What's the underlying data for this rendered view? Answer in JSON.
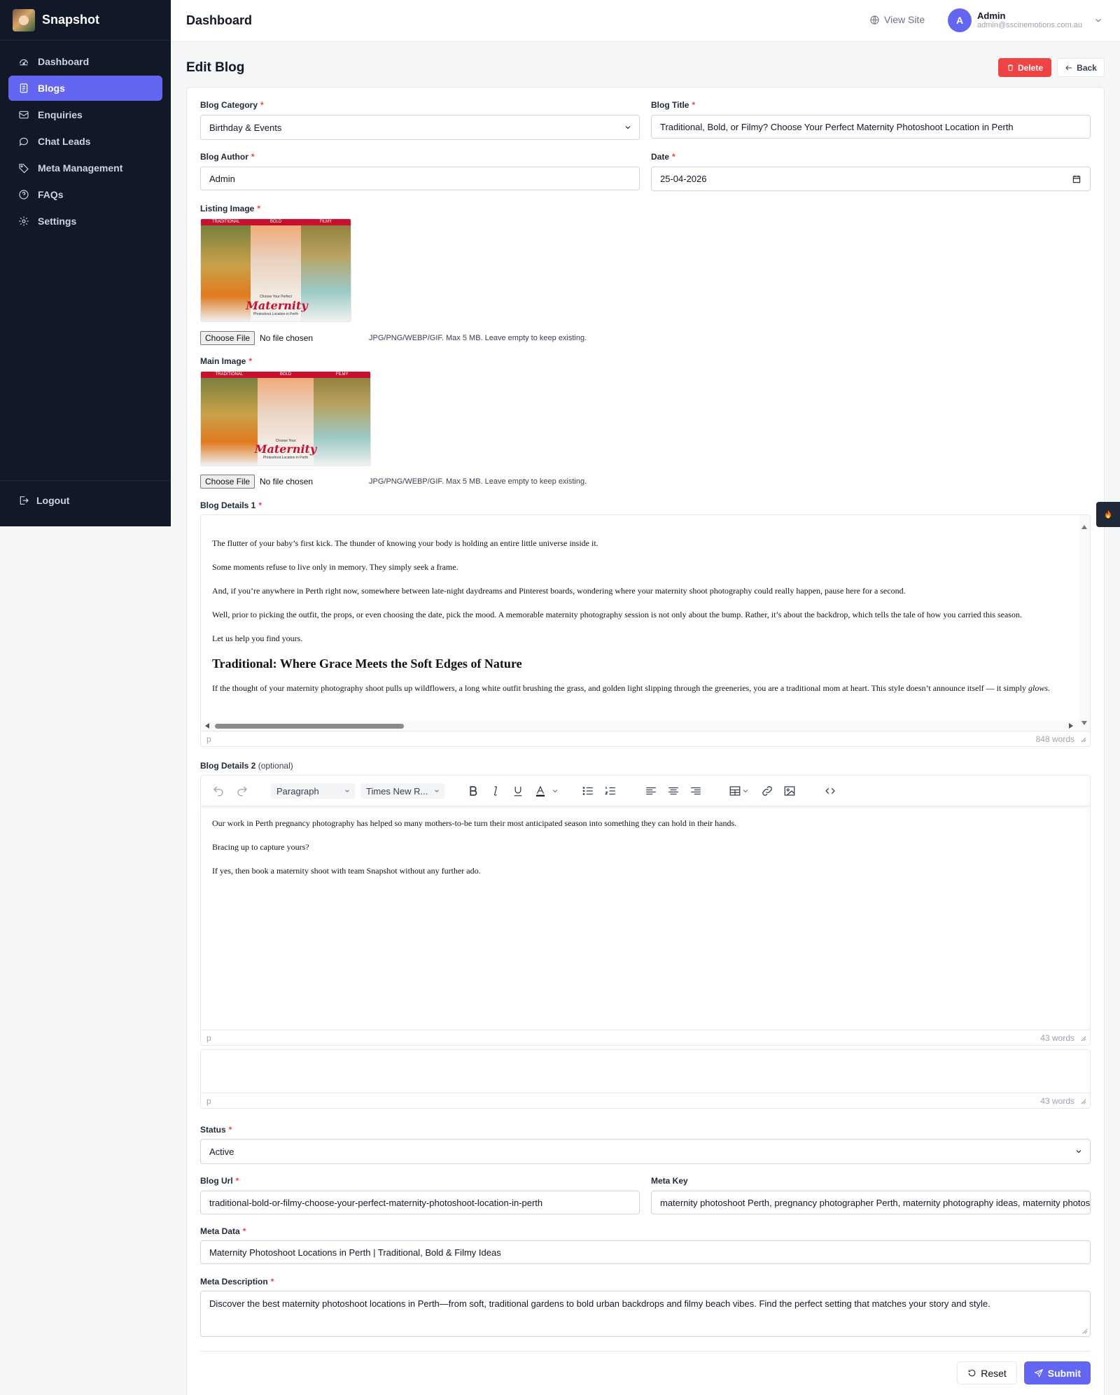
{
  "brand": {
    "name": "Snapshot"
  },
  "sidebar": {
    "items": [
      {
        "label": "Dashboard",
        "icon": "dashboard-icon"
      },
      {
        "label": "Blogs",
        "icon": "document-icon",
        "active": true
      },
      {
        "label": "Enquiries",
        "icon": "mail-icon"
      },
      {
        "label": "Chat Leads",
        "icon": "chat-icon"
      },
      {
        "label": "Meta Management",
        "icon": "tag-icon"
      },
      {
        "label": "FAQs",
        "icon": "help-icon"
      },
      {
        "label": "Settings",
        "icon": "gear-icon"
      }
    ],
    "logout": "Logout"
  },
  "header": {
    "title": "Dashboard",
    "view_site": "View Site",
    "user": {
      "initial": "A",
      "name": "Admin",
      "email": "admin@sscinemotions.com.au"
    }
  },
  "page": {
    "title": "Edit Blog",
    "delete_label": "Delete",
    "back_label": "Back"
  },
  "form": {
    "category": {
      "label": "Blog Category",
      "value": "Birthday & Events"
    },
    "title": {
      "label": "Blog Title",
      "value": "Traditional, Bold, or Filmy? Choose Your Perfect Maternity Photoshoot Location in Perth"
    },
    "author": {
      "label": "Blog Author",
      "value": "Admin"
    },
    "date": {
      "label": "Date",
      "value": "25-04-2026"
    },
    "listing_image": {
      "label": "Listing Image",
      "panels": [
        "TRADITIONAL",
        "BOLD",
        "FILMY"
      ],
      "overlay_small": "Choose Your Perfect",
      "overlay_script": "Maternity",
      "overlay_sub": "Photoshoot Location in Perth",
      "choose_label": "Choose File",
      "file_status": "No file chosen",
      "hint": "JPG/PNG/WEBP/GIF. Max 5 MB. Leave empty to keep existing."
    },
    "main_image": {
      "label": "Main Image",
      "panels": [
        "TRADITIONAL",
        "BOLD",
        "FILMY"
      ],
      "overlay_small": "Choose Your",
      "overlay_script": "Maternity",
      "overlay_sub": "Photoshoot Location in Perth",
      "choose_label": "Choose File",
      "file_status": "No file chosen",
      "hint": "JPG/PNG/WEBP/GIF. Max 5 MB. Leave empty to keep existing."
    },
    "details1": {
      "label": "Blog Details 1",
      "paragraphs": [
        "The flutter of your baby’s first kick. The thunder of knowing your body is holding an entire little universe inside it.",
        "Some moments refuse to live only in memory. They simply seek a frame.",
        "And, if you’re anywhere in Perth right now, somewhere between late-night daydreams and Pinterest boards, wondering where your maternity shoot photography could really happen, pause here for a second.",
        "Well, prior to picking the outfit, the props, or even choosing the date, pick the mood. A memorable maternity photography session is not only about the bump. Rather, it’s about the backdrop, which tells the tale of how you carried this season.",
        "Let us help you find yours."
      ],
      "heading": "Traditional: Where Grace Meets the Soft Edges of Nature",
      "last_paragraph": "If the thought of your maternity photography shoot pulls up wildflowers, a long white outfit brushing the grass, and golden light slipping through the greeneries, you are a traditional mom at heart. This style doesn’t announce itself — it simply",
      "last_paragraph_em": "glows",
      "path": "p",
      "word_count": "848 words"
    },
    "details2": {
      "label": "Blog Details 2",
      "optional": "(optional)",
      "block_format": "Paragraph",
      "font_family": "Times New R...",
      "paragraphs": [
        "Our work in Perth pregnancy photography has helped so many mothers-to-be turn their most anticipated season into something they can hold in their hands.",
        "Bracing up to capture yours?",
        "If yes, then book a maternity shoot with team Snapshot without any further ado."
      ],
      "path": "p",
      "word_count": "43 words",
      "extra_path": "p",
      "extra_word_count": "43 words"
    },
    "status": {
      "label": "Status",
      "value": "Active"
    },
    "blog_url": {
      "label": "Blog Url",
      "value": "traditional-bold-or-filmy-choose-your-perfect-maternity-photoshoot-location-in-perth"
    },
    "meta_key": {
      "label": "Meta Key",
      "value": "maternity photoshoot Perth, pregnancy photographer Perth, maternity photography ideas, maternity photoshoot locations Perth"
    },
    "meta_data": {
      "label": "Meta Data",
      "value": "Maternity Photoshoot Locations in Perth | Traditional, Bold & Filmy Ideas"
    },
    "meta_description": {
      "label": "Meta Description",
      "value": "Discover the best maternity photoshoot locations in Perth—from soft, traditional gardens to bold urban backdrops and filmy beach vibes. Find the perfect setting that matches your story and style."
    },
    "reset_label": "Reset",
    "submit_label": "Submit"
  },
  "colors": {
    "accent": "#6366f1",
    "danger": "#ef4444",
    "sidebar": "#111827",
    "required": "#ef4444"
  }
}
